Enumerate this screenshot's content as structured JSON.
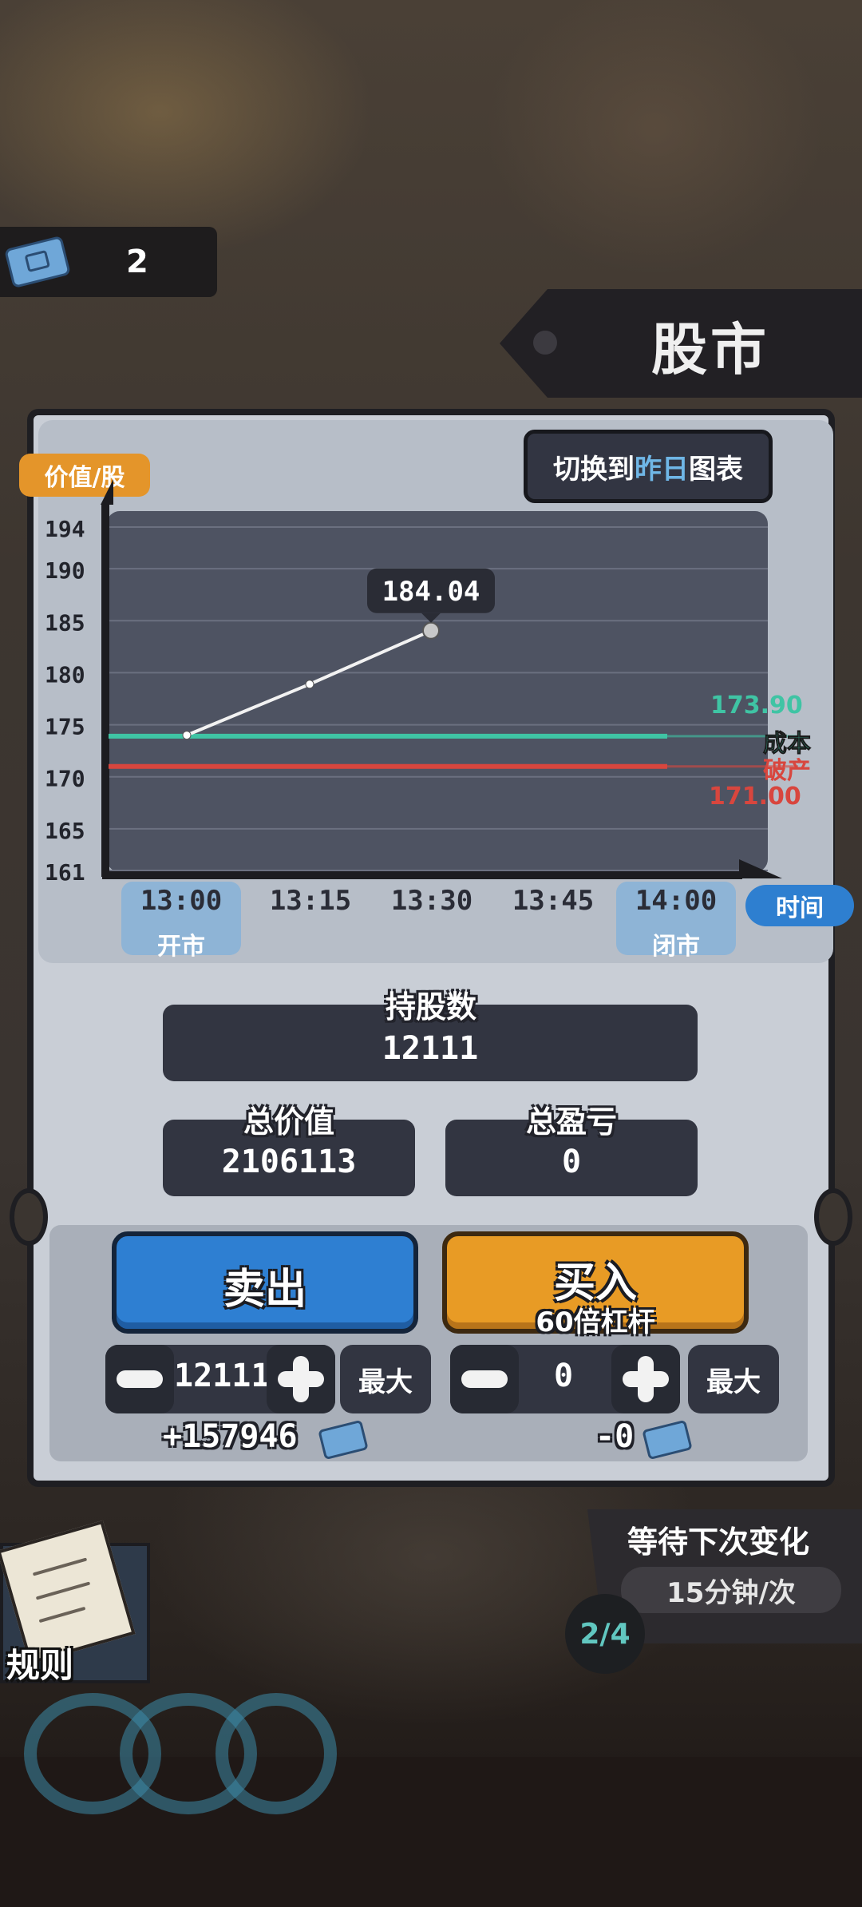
{
  "header": {
    "currency_value": "2",
    "title": "股市"
  },
  "chart_header": {
    "y_badge": "价值/股",
    "switch_prefix": "切换到",
    "switch_highlight": "昨日",
    "switch_suffix": "图表"
  },
  "x_axis": {
    "ticks": [
      "13:00",
      "13:15",
      "13:30",
      "13:45",
      "14:00"
    ],
    "open_label": "开市",
    "close_label": "闭市",
    "badge": "时间"
  },
  "chart_data": {
    "type": "line",
    "title": "",
    "ylabel": "价值/股",
    "xlabel": "时间",
    "ylim": [
      161,
      194
    ],
    "y_ticks": [
      194,
      190,
      185,
      180,
      175,
      170,
      165,
      161
    ],
    "x": [
      "13:00",
      "13:15",
      "13:30",
      "13:45",
      "14:00"
    ],
    "series": [
      {
        "values": [
          174.0,
          178.9,
          184.04
        ]
      }
    ],
    "current_point_label": "184.04",
    "reference_lines": [
      {
        "name": "成本",
        "value": 173.9,
        "label": "173.90",
        "color": "#3fc4a4"
      },
      {
        "name": "破产",
        "value": 171.0,
        "label": "171.00",
        "color": "#d8463e"
      }
    ],
    "grid": true
  },
  "stats": {
    "holdings_label": "持股数",
    "holdings_value": "12111",
    "total_value_label": "总价值",
    "total_value": "2106113",
    "total_pl_label": "总盈亏",
    "total_pl": "0"
  },
  "trade": {
    "sell_label": "卖出",
    "buy_label": "买入",
    "leverage_label": "60倍杠杆",
    "sell_qty": "12111",
    "buy_qty": "0",
    "max_label": "最大",
    "sell_result": "+157946",
    "buy_result": "-0"
  },
  "wait": {
    "title": "等待下次变化",
    "interval": "15分钟/次",
    "round": "2/4"
  },
  "rules": {
    "label": "规则"
  },
  "colors": {
    "accent_orange": "#e4952a",
    "accent_blue": "#2e7fd0",
    "cost_line": "#3fc4a4",
    "bankrupt_line": "#d8463e"
  }
}
